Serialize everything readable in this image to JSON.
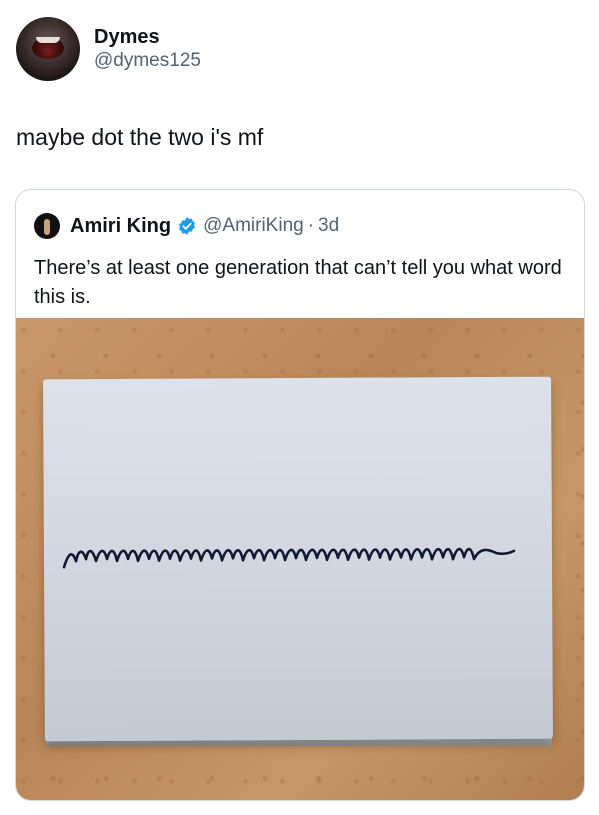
{
  "post": {
    "author": {
      "display_name": "Dymes",
      "handle": "@dymes125",
      "avatar": "avatar-open-mouth"
    },
    "text": "maybe dot the two i's mf"
  },
  "quote": {
    "author": {
      "display_name": "Amiri King",
      "handle": "@AmiriKing",
      "separator": "·",
      "time": "3d",
      "verified": true,
      "verified_color": "#1d9bf0"
    },
    "text": "There’s at least one generation that can’t tell you what word this is.",
    "image": {
      "handwritten_word": "minimum",
      "description_icon": "sticky-note"
    }
  },
  "colors": {
    "text": "#0f1419",
    "secondary": "#536471",
    "border": "#cfd9de"
  }
}
